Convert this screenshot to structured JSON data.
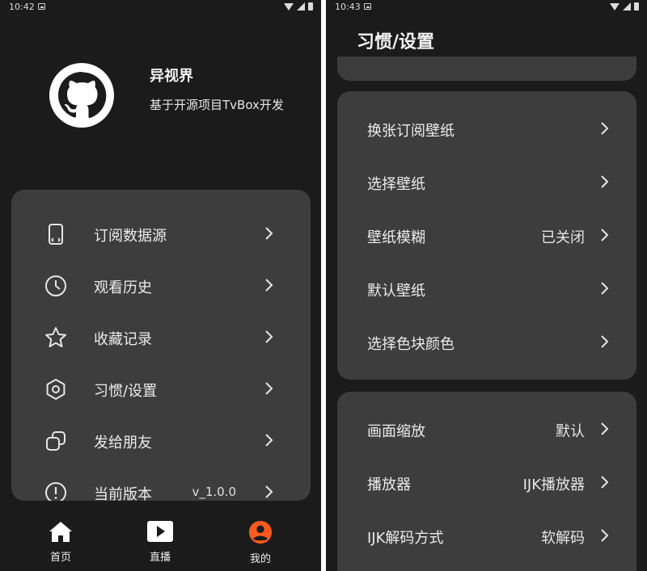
{
  "left_screen": {
    "status_bar": {
      "time": "10:42"
    },
    "profile": {
      "name": "异视界",
      "description": "基于开源项目TvBox开发"
    },
    "menu": [
      {
        "label": "订阅数据源",
        "icon": "subscription-source-icon",
        "value": ""
      },
      {
        "label": "观看历史",
        "icon": "clock-icon",
        "value": ""
      },
      {
        "label": "收藏记录",
        "icon": "star-icon",
        "value": ""
      },
      {
        "label": "习惯/设置",
        "icon": "hexagon-settings-icon",
        "value": ""
      },
      {
        "label": "发给朋友",
        "icon": "share-icon",
        "value": ""
      },
      {
        "label": "当前版本",
        "icon": "info-icon",
        "value": "v_1.0.0"
      }
    ],
    "bottom_nav": [
      {
        "label": "首页",
        "icon": "home-icon",
        "active": false
      },
      {
        "label": "直播",
        "icon": "play-icon",
        "active": false
      },
      {
        "label": "我的",
        "icon": "user-icon",
        "active": true
      }
    ]
  },
  "right_screen": {
    "status_bar": {
      "time": "10:43"
    },
    "title": "习惯/设置",
    "card1": [
      {
        "label": "换张订阅壁纸",
        "value": ""
      },
      {
        "label": "选择壁纸",
        "value": ""
      },
      {
        "label": "壁纸模糊",
        "value": "已关闭"
      },
      {
        "label": "默认壁纸",
        "value": ""
      },
      {
        "label": "选择色块颜色",
        "value": ""
      }
    ],
    "card2": [
      {
        "label": "画面缩放",
        "value": "默认"
      },
      {
        "label": "播放器",
        "value": "IJK播放器"
      },
      {
        "label": "IJK解码方式",
        "value": "软解码"
      }
    ]
  },
  "colors": {
    "background": "#1b1b1b",
    "card": "#3d3d3d",
    "accent_orange": "#ff5a1f",
    "text": "#ececec"
  }
}
